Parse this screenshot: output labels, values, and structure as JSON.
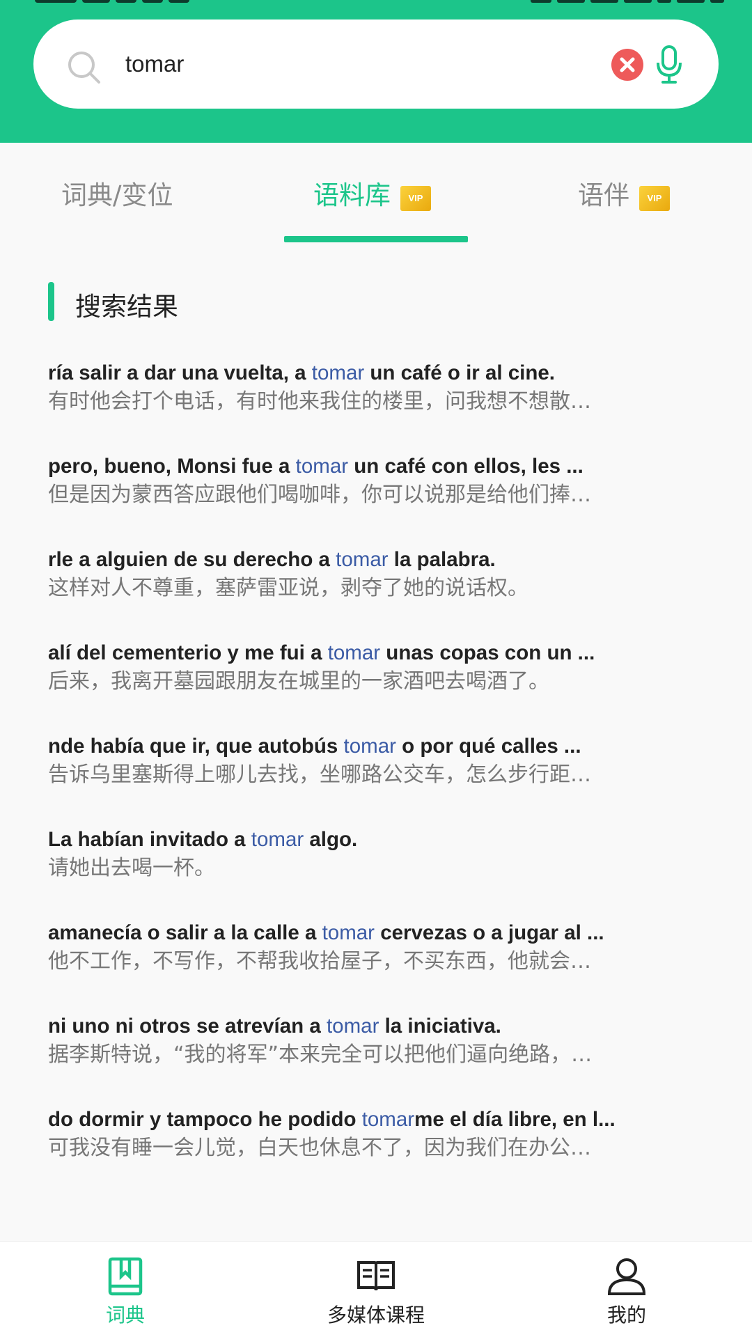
{
  "search": {
    "value": "tomar"
  },
  "tabs": [
    {
      "label": "词典/变位",
      "vip": ""
    },
    {
      "label": "语料库",
      "vip": "VIP"
    },
    {
      "label": "语伴",
      "vip": "VIP"
    }
  ],
  "section": {
    "title": "搜索结果"
  },
  "results": [
    {
      "pre": "ría salir a dar una vuelta, a ",
      "hl": "tomar",
      "post": " un café o ir al cine.",
      "zh": "有时他会打个电话，有时他来我住的楼里，问我想不想散…"
    },
    {
      "pre": "pero, bueno, Monsi fue a ",
      "hl": "tomar",
      "post": " un café con ellos, les ...",
      "zh": "但是因为蒙西答应跟他们喝咖啡，你可以说那是给他们捧…"
    },
    {
      "pre": "rle a alguien de su derecho a ",
      "hl": "tomar",
      "post": " la palabra.",
      "zh": "这样对人不尊重，塞萨雷亚说，剥夺了她的说话权。"
    },
    {
      "pre": "alí del cementerio y me fui a ",
      "hl": "tomar",
      "post": " unas copas con un ...",
      "zh": "后来，我离开墓园跟朋友在城里的一家酒吧去喝酒了。"
    },
    {
      "pre": "nde había que ir, que autobús ",
      "hl": "tomar",
      "post": " o por qué calles ...",
      "zh": "告诉乌里塞斯得上哪儿去找，坐哪路公交车，怎么步行距…"
    },
    {
      "pre": "La habían invitado a ",
      "hl": "tomar",
      "post": " algo.",
      "zh": "请她出去喝一杯。"
    },
    {
      "pre": "amanecía o salir a la calle a ",
      "hl": "tomar",
      "post": " cervezas o a jugar al ...",
      "zh": "他不工作，不写作，不帮我收拾屋子，不买东西，他就会…"
    },
    {
      "pre": "ni uno ni otros se atrevían a ",
      "hl": "tomar",
      "post": " la iniciativa.",
      "zh": "据李斯特说，“我的将军”本来完全可以把他们逼向绝路，…"
    },
    {
      "pre": "do dormir y tampoco he podido ",
      "hl": "tomar",
      "post": "me el día libre, en l...",
      "zh": "可我没有睡一会儿觉，白天也休息不了，因为我们在办公…"
    }
  ],
  "bottom_nav": [
    {
      "label": "词典",
      "icon": "dictionary-book-icon"
    },
    {
      "label": "多媒体课程",
      "icon": "open-book-icon"
    },
    {
      "label": "我的",
      "icon": "user-icon"
    }
  ],
  "colors": {
    "accent": "#1cc58a",
    "highlight": "#3b5ba5",
    "clear": "#ee5a5a",
    "vip": "#f2be22"
  }
}
